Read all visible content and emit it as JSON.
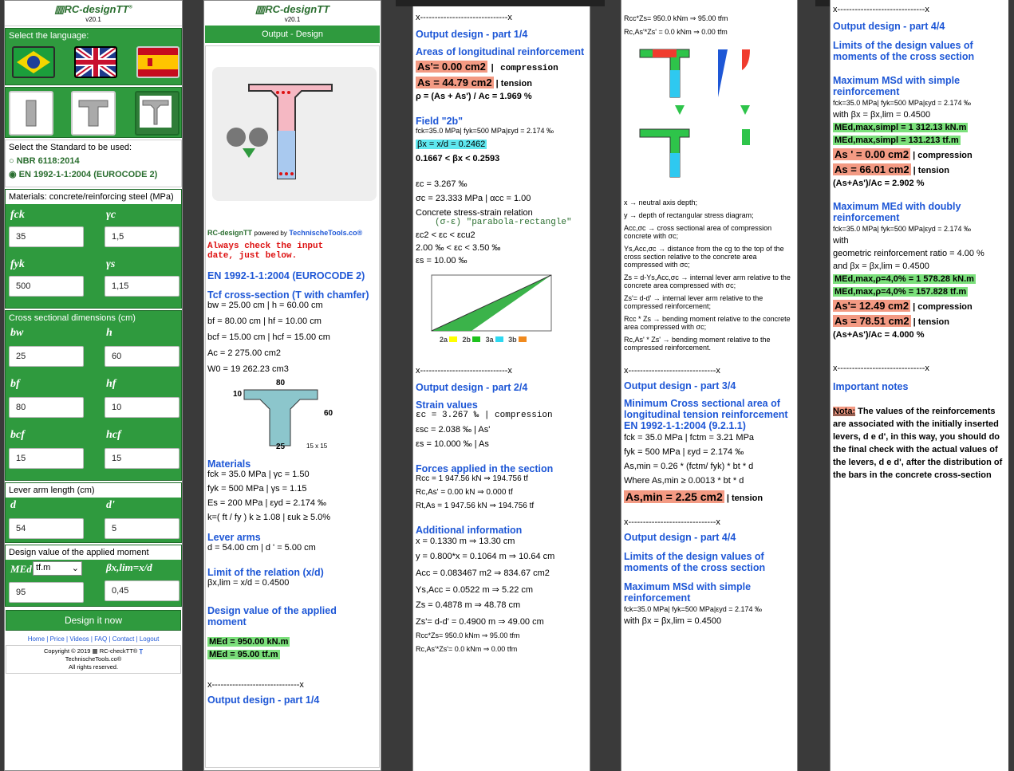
{
  "app": {
    "name": "RC-designTT",
    "tm": "®",
    "version": "v20.1"
  },
  "col1": {
    "select_language": "Select the language:",
    "select_standard": "Select the Standard to be used:",
    "standards": [
      "NBR 6118:2014",
      "EN 1992-1-1:2004 (EUROCODE 2)"
    ],
    "materials_title": "Materials: concrete/reinforcing steel (MPa)",
    "fck_label": "fck",
    "fck": "35",
    "gc_label": "γc",
    "gc": "1,5",
    "fyk_label": "fyk",
    "fyk": "500",
    "gs_label": "γs",
    "gs": "1,15",
    "dims_title": "Cross sectional dimensions (cm)",
    "bw_label": "bw",
    "bw": "25",
    "h_label": "h",
    "h": "60",
    "bf_label": "bf",
    "bf": "80",
    "hf_label": "hf",
    "hf": "10",
    "bcf_label": "bcf",
    "bcf": "15",
    "hcf_label": "hcf",
    "hcf": "15",
    "lever_title": "Lever arm length (cm)",
    "d_label": "d",
    "d": "54",
    "dp_label": "d'",
    "dp": "5",
    "moment_title": "Design value of the applied moment",
    "med_label": "MEd",
    "med_unit": "tf.m",
    "med": "95",
    "bx_label": "βx,lim=x/d",
    "bx": "0,45",
    "design_btn": "Design it now",
    "links": [
      "Home",
      "Price",
      "Videos",
      "FAQ",
      "Contact",
      "Logout"
    ],
    "copyright": "Copyright © 2019",
    "checktt": "RC-checkTT®",
    "site": "TechnischeTools.co®",
    "rights": "All rights reserved."
  },
  "col2": {
    "header_btn": "Output - Design",
    "powered": "powered by",
    "tt": "TechnischeTools.co®",
    "warn1": "Always check the input",
    "warn2": "date, just below.",
    "std": "EN 1992-1-1:2004 (EUROCODE 2)",
    "tcf": "Tcf cross-section (T with chamfer)",
    "l1": "bw = 25.00 cm | h = 60.00 cm",
    "l2": "bf = 80.00 cm | hf = 10.00 cm",
    "l3": "bcf = 15.00 cm | hcf = 15.00 cm",
    "l4": "Ac = 2 275.00 cm2",
    "l5": "W0 = 19 262.23 cm3",
    "fig": {
      "top": "80",
      "left": "10",
      "right": "60",
      "bottom": "25",
      "chamfer": "15 x 15"
    },
    "mat_title": "Materials",
    "m1": "fck = 35.0 MPa | γc = 1.50",
    "m2": "fyk = 500 MPa | γs = 1.15",
    "m3": "Es = 200 MPa | εyd = 2.174 ‰",
    "m4": "k=( ft / fy ) k ≥ 1.08 | εuk ≥ 5.0%",
    "lever_title": "Lever arms",
    "lever": "d = 54.00 cm | d ' = 5.00 cm",
    "lim_title": "Limit of the relation (x/d)",
    "lim": "βx,lim = x/d = 0.4500",
    "dv_title": "Design value of the applied moment",
    "med1": "MEd = 950.00 kN.m",
    "med2": "MEd = 95.00 tf.m",
    "sep": "x------------------------------x",
    "part1": "Output design - part 1/4"
  },
  "col3": {
    "sep": "x------------------------------x",
    "p1": "Output design - part 1/4",
    "areas": "Areas of longitudinal reinforcement",
    "as1": "As'= 0.00 cm2",
    "as1t": "| compression",
    "as2": "As = 44.79 cm2",
    "as2t": "| tension",
    "rho": "ρ = (As + As') / Ac = 1.969 %",
    "field": "Field \"2b\"",
    "fl1": "fck=35.0 MPa| fyk=500 MPa|εyd = 2.174 ‰",
    "bx": "βx = x/d = 0.2462",
    "range": "0.1667 < βx < 0.2593",
    "ec": "εc = 3.267 ‰",
    "sc": "σc = 23.333 MPa | αcc = 1.00",
    "csr": "Concrete stress-strain relation",
    "pr": "(σ-ε) \"parabola-rectangle\"",
    "ecr": "εc2 < εc < εcu2",
    "ecr2": "2.00 ‰ < εc < 3.50 ‰",
    "es": "εs = 10.00 ‰",
    "legend": [
      "2a",
      "2b",
      "3a",
      "3b"
    ],
    "p2": "Output design - part 2/4",
    "strain": "Strain values",
    "st1": "εc = 3.267 ‰ | compression",
    "st2": "εsc = 2.038 ‰ | As'",
    "st3": "εs = 10.000 ‰ | As",
    "forces": "Forces applied in the section",
    "fo1": "Rcc = 1 947.56 kN ⇒ 194.756 tf",
    "fo2": "Rc,As' = 0.00 kN ⇒ 0.000 tf",
    "fo3": "Rt,As = 1 947.56 kN ⇒ 194.756 tf",
    "add": "Additional information",
    "ad1": "x = 0.1330 m ⇒ 13.30 cm",
    "ad2": "y = 0.800*x = 0.1064 m ⇒ 10.64 cm",
    "ad3": "Acc = 0.083467 m2 ⇒ 834.67 cm2",
    "ad4": "Ys,Acc = 0.0522 m ⇒ 5.22 cm",
    "ad5": "Zs = 0.4878 m ⇒ 48.78 cm",
    "ad6": "Zs'= d-d' = 0.4900 m ⇒ 49.00 cm",
    "ad7": "Rcc*Zs= 950.0 kNm ⇒ 95.00 tfm",
    "ad8": "Rc,As'*Zs'= 0.0 kNm ⇒ 0.00 tfm"
  },
  "col4": {
    "t1": "Rcc*Zs= 950.0 kNm ⇒ 95.00 tfm",
    "t2": "Rc,As'*Zs' = 0.0 kNm ⇒ 0.00 tfm",
    "n1": "x → neutral axis depth;",
    "n2": "y → depth of rectangular stress diagram;",
    "n3": "Acc,σc → cross sectional area of compression concrete with σc;",
    "n4": "Ys,Acc,σc → distance from the cg to the top of the cross section relative to the concrete area compressed with σc;",
    "n5": "Zs = d-Ys,Acc,σc → internal lever arm relative to the concrete area compressed with σc;",
    "n6": "Zs'= d-d' → internal lever arm relative to the compressed reinforcement;",
    "n7": "Rcc * Zs → bending moment relative to the concrete area compressed with σc;",
    "n8": "Rc,As' * Zs' → bending moment relative to the compressed reinforcement.",
    "sep": "x------------------------------x",
    "p3": "Output design - part 3/4",
    "min": "Minimum Cross sectional area of longitudinal tension reinforcement EN 1992-1-1:2004 (9.2.1.1)",
    "m1": "fck = 35.0 MPa | fctm = 3.21 MPa",
    "m2": "fyk = 500 MPa | εyd = 2.174 ‰",
    "m3": "As,min = 0.26 * (fctm/ fyk) * bt * d",
    "m4": "Where As,min ≥ 0.0013 * bt * d",
    "m5": "As,min = 2.25 cm2",
    "m5t": "| tension",
    "p4": "Output design - part 4/4",
    "lim": "Limits of the design values of moments of the cross section",
    "max": "Maximum MSd with simple reinforcement",
    "mx1": "fck=35.0 MPa| fyk=500 MPa|εyd = 2.174 ‰",
    "mx2": "with βx = βx,lim = 0.4500"
  },
  "col5": {
    "sep": "x------------------------------x",
    "p4": "Output design - part 4/4",
    "lim": "Limits of the design values of moments of the cross section",
    "max1": "Maximum MSd with simple reinforcement",
    "a1": "fck=35.0 MPa| fyk=500 MPa|εyd = 2.174 ‰",
    "a2": "with βx = βx,lim = 0.4500",
    "a3": "MEd,max,simpl = 1 312.13 kN.m",
    "a4": "MEd,max,simpl = 131.213 tf.m",
    "a5": "As ' = 0.00 cm2",
    "a5t": "| compression",
    "a6": "As = 66.01 cm2",
    "a6t": "| tension",
    "a7": "(As+As')/Ac = 2.902 %",
    "max2": "Maximum MEd with doubly reinforcement",
    "b1": "fck=35.0 MPa| fyk=500 MPa|εyd = 2.174 ‰",
    "b2": "with",
    "b3": "geometric reinforcement ratio = 4.00 %",
    "b4": "and βx = βx,lim = 0.4500",
    "b5": "MEd,max,ρ=4,0% = 1 578.28 kN.m",
    "b6": "MEd,max,ρ=4,0% = 157.828 tf.m",
    "b7": "As'= 12.49 cm2",
    "b7t": "| compression",
    "b8": "As = 78.51 cm2",
    "b8t": "| tension",
    "b9": "(As+As')/Ac = 4.000 %",
    "notes": "Important notes",
    "note_lbl": "Nota:",
    "note": "The values of the reinforcements are associated with the initially inserted levers, d e d', in this way, you should do the final check with the actual values of the levers, d e d', after the distribution of the bars in the concrete cross-section"
  }
}
